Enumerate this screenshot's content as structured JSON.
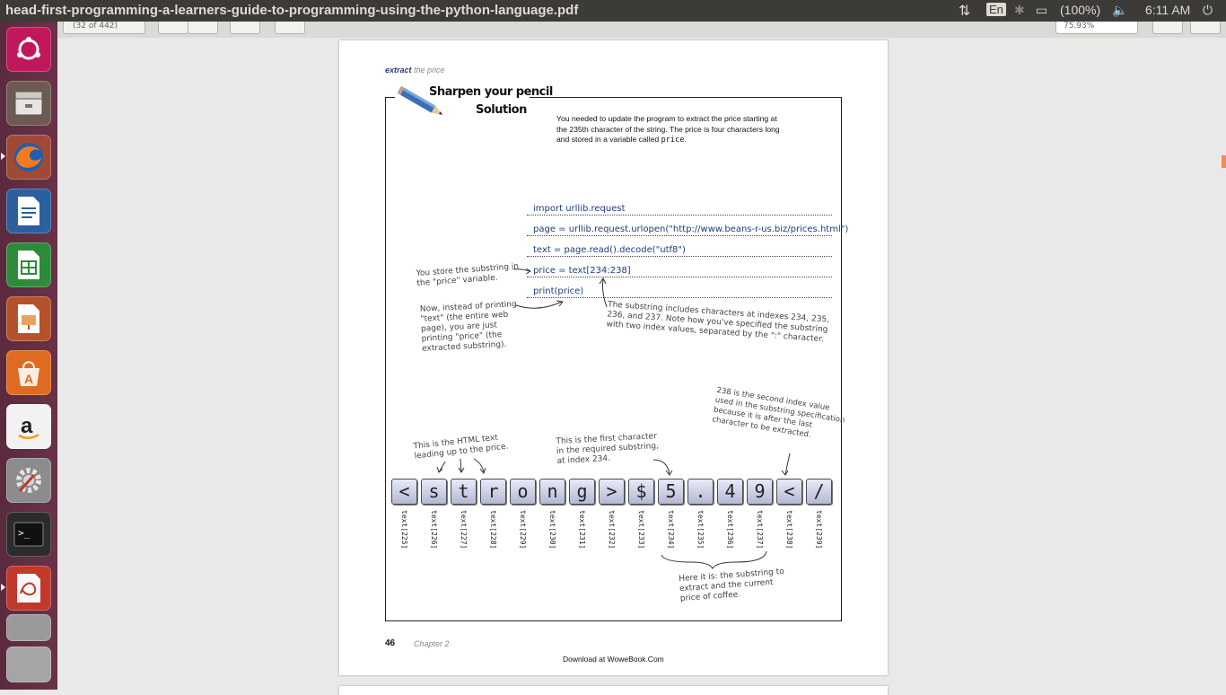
{
  "window": {
    "title": "head-first-programming-a-learners-guide-to-programming-using-the-python-language.pdf"
  },
  "panel": {
    "keyboard": "En",
    "battery": "(100%)",
    "clock": "6:11 AM"
  },
  "toolbar": {
    "page_indicator": "(32 of 442)",
    "zoom": "75.93%"
  },
  "launcher": {
    "apps": [
      "ubuntu-home",
      "files",
      "firefox",
      "writer",
      "calc",
      "impress",
      "software-center",
      "amazon",
      "system-settings",
      "terminal",
      "document-viewer",
      "workspaces",
      "trash"
    ]
  },
  "page": {
    "header_bold": "extract",
    "header_rest": "the price",
    "badge_line1": "Sharpen your pencil",
    "badge_line2": "Solution",
    "intro_line1": "You needed to update the program to extract the price starting at",
    "intro_line2": "the 235th character of the string. The price is four characters long",
    "intro_line3": "and stored in a variable called",
    "intro_code": "price",
    "intro_end": ".",
    "code": [
      "import urllib.request",
      "page = urllib.request.urlopen(\"http://www.beans-r-us.biz/prices.html\")",
      "text = page.read().decode(\"utf8\")",
      "price = text[234:238]",
      "print(price)"
    ],
    "note_store": [
      "You store the substring in",
      "the \"price\" variable."
    ],
    "note_print": [
      "Now, instead of printing",
      "\"text\" (the entire web",
      "page), you are just",
      "printing \"price\" (the",
      "extracted substring)."
    ],
    "note_substring": [
      "The substring includes characters at indexes 234, 235,",
      "236, and 237. Note how you've specified the substring",
      "with two index values, separated by the \":\" character."
    ],
    "note_html": [
      "This is the HTML text",
      "leading up to the price."
    ],
    "note_first": [
      "This is the first character",
      "in the required substring,",
      "at index 234."
    ],
    "note_238": [
      "238 is the second index value",
      "used in the substring specification",
      "because it is after the last",
      "character to be extracted."
    ],
    "chars": [
      "<",
      "s",
      "t",
      "r",
      "o",
      "n",
      "g",
      ">",
      "$",
      "5",
      ".",
      "4",
      "9",
      "<",
      "/"
    ],
    "char_labels": [
      "text[225]",
      "text[226]",
      "text[227]",
      "text[228]",
      "text[229]",
      "text[230]",
      "text[231]",
      "text[232]",
      "text[233]",
      "text[234]",
      "text[235]",
      "text[236]",
      "text[237]",
      "text[238]",
      "text[239]"
    ],
    "note_coffee": [
      "Here it is: the substring to",
      "extract and the current",
      "price of coffee."
    ],
    "page_number": "46",
    "chapter": "Chapter 2",
    "download": "Download at WoweBook.Com"
  }
}
